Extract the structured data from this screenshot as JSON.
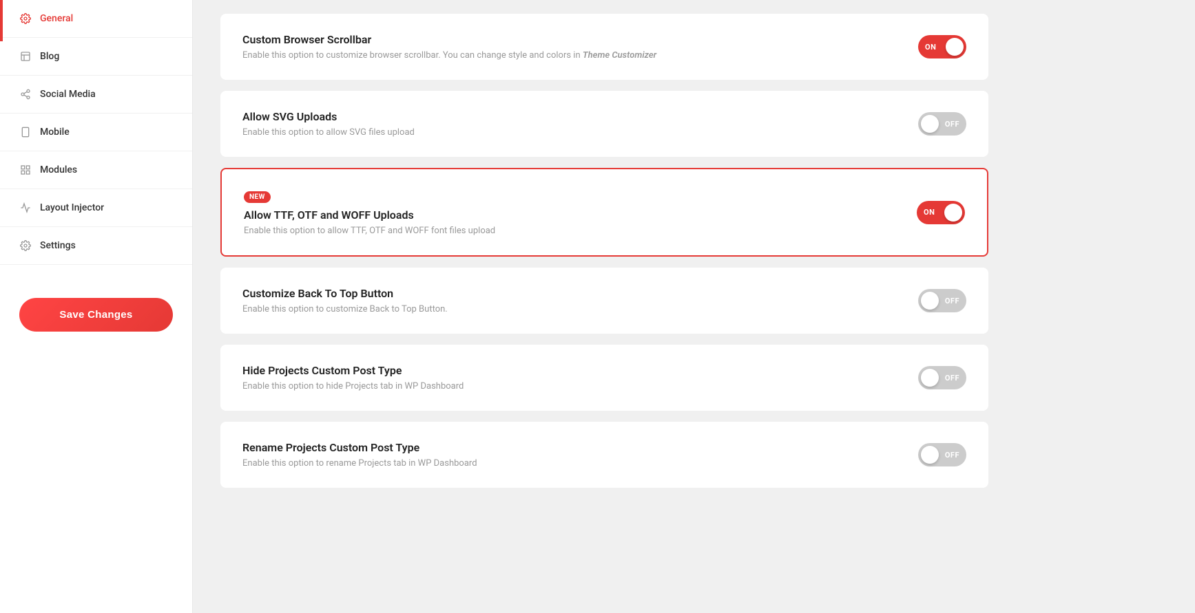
{
  "sidebar": {
    "items": [
      {
        "id": "general",
        "label": "General",
        "icon": "gear-icon",
        "active": true
      },
      {
        "id": "blog",
        "label": "Blog",
        "icon": "blog-icon",
        "active": false
      },
      {
        "id": "social-media",
        "label": "Social Media",
        "icon": "share-icon",
        "active": false
      },
      {
        "id": "mobile",
        "label": "Mobile",
        "icon": "mobile-icon",
        "active": false
      },
      {
        "id": "modules",
        "label": "Modules",
        "icon": "modules-icon",
        "active": false
      },
      {
        "id": "layout-injector",
        "label": "Layout Injector",
        "icon": "layout-icon",
        "active": false
      },
      {
        "id": "settings",
        "label": "Settings",
        "icon": "settings-icon",
        "active": false
      }
    ],
    "save_button_label": "Save Changes"
  },
  "settings": [
    {
      "id": "custom-browser-scrollbar",
      "title": "Custom Browser Scrollbar",
      "description": "Enable this option to customize browser scrollbar. You can change style and colors in ",
      "description_link": "Theme Customizer",
      "toggle_state": "on",
      "new_badge": false,
      "highlighted": false
    },
    {
      "id": "allow-svg-uploads",
      "title": "Allow SVG Uploads",
      "description": "Enable this option to allow SVG files upload",
      "description_link": "",
      "toggle_state": "off",
      "new_badge": false,
      "highlighted": false
    },
    {
      "id": "allow-ttf-otf-woff",
      "title": "Allow TTF, OTF and WOFF Uploads",
      "description": "Enable this option to allow TTF, OTF and WOFF font files upload",
      "description_link": "",
      "toggle_state": "on",
      "new_badge": true,
      "new_badge_label": "NEW",
      "highlighted": true
    },
    {
      "id": "customize-back-to-top",
      "title": "Customize Back To Top Button",
      "description": "Enable this option to customize Back to Top Button.",
      "description_link": "",
      "toggle_state": "off",
      "new_badge": false,
      "highlighted": false
    },
    {
      "id": "hide-projects-custom-post-type",
      "title": "Hide Projects Custom Post Type",
      "description": "Enable this option to hide Projects tab in WP Dashboard",
      "description_link": "",
      "toggle_state": "off",
      "new_badge": false,
      "highlighted": false
    },
    {
      "id": "rename-projects-custom-post-type",
      "title": "Rename Projects Custom Post Type",
      "description": "Enable this option to rename Projects tab in WP Dashboard",
      "description_link": "",
      "toggle_state": "off",
      "new_badge": false,
      "highlighted": false
    }
  ],
  "colors": {
    "accent": "#e53935",
    "toggle_on": "#e53935",
    "toggle_off": "#cccccc"
  }
}
